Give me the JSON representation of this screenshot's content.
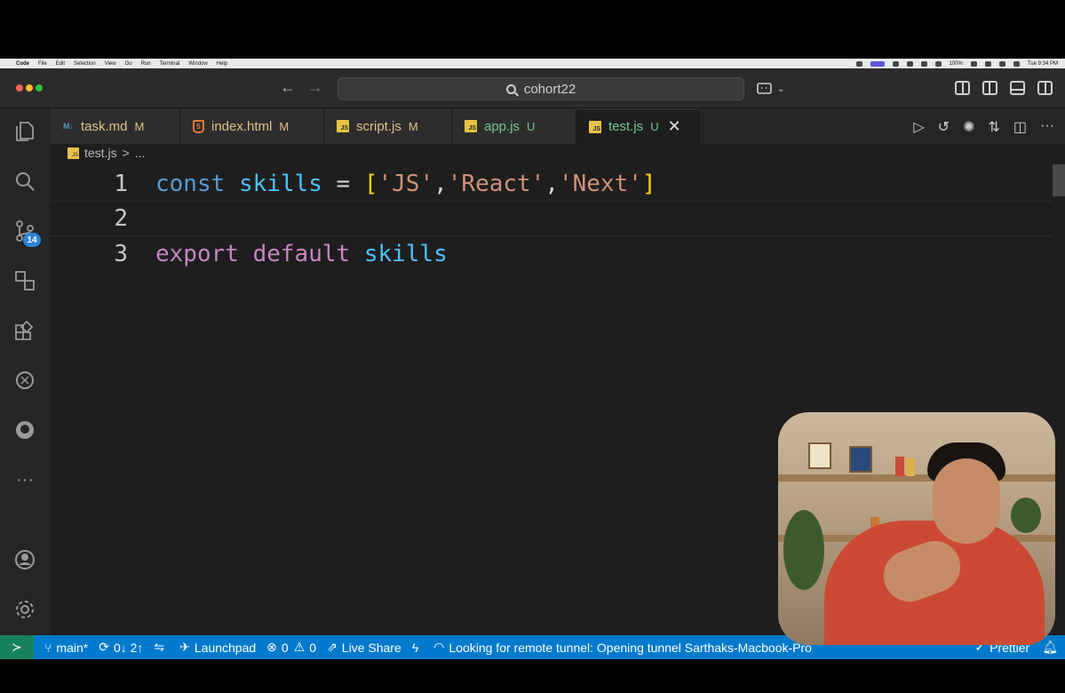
{
  "menubar": {
    "app": "Code",
    "items": [
      "File",
      "Edit",
      "Selection",
      "View",
      "Go",
      "Run",
      "Terminal",
      "Window",
      "Help"
    ],
    "battery": "100%",
    "clock": "Tue 9:34 PM"
  },
  "titlebar": {
    "search_text": "cohort22"
  },
  "activitybar": {
    "scm_badge": "14"
  },
  "tabs": [
    {
      "name": "task.md",
      "status": "M",
      "type": "md",
      "icon_text": "M↓"
    },
    {
      "name": "index.html",
      "status": "M",
      "type": "html",
      "icon_text": "5"
    },
    {
      "name": "script.js",
      "status": "M",
      "type": "js",
      "icon_text": "JS"
    },
    {
      "name": "app.js",
      "status": "U",
      "type": "js",
      "icon_text": "JS"
    },
    {
      "name": "test.js",
      "status": "U",
      "type": "js",
      "icon_text": "JS",
      "active": true
    }
  ],
  "breadcrumb": {
    "file": "test.js",
    "sep": ">",
    "more": "..."
  },
  "editor": {
    "lines": [
      {
        "num": "1"
      },
      {
        "num": "2"
      },
      {
        "num": "3"
      }
    ],
    "line1": {
      "kw": "const",
      "name": "skills",
      "eq": "=",
      "open": "[",
      "s1": "'JS'",
      "c1": ",",
      "s2": "'React'",
      "c2": ",",
      "s3": "'Next'",
      "close": "]"
    },
    "line3": {
      "kw1": "export",
      "kw2": "default",
      "name": "skills"
    }
  },
  "statusbar": {
    "branch": "main*",
    "sync": "0↓ 2↑",
    "launchpad": "Launchpad",
    "errors": "0",
    "warnings": "0",
    "liveshare": "Live Share",
    "tunnel": "Looking for remote tunnel: Opening tunnel Sarthaks-Macbook-Pro",
    "prettier": "Prettier"
  }
}
